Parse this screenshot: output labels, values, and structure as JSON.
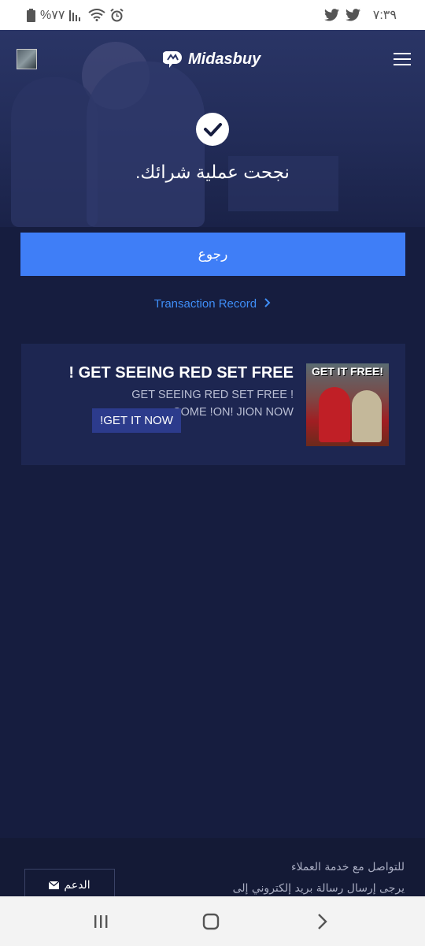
{
  "status_bar": {
    "battery": "%٧٧",
    "time": "٧:٣٩"
  },
  "header": {
    "brand": "Midasbuy"
  },
  "result": {
    "message": "نجحت عملية شرائك."
  },
  "actions": {
    "back_label": "رجوع",
    "transaction_link": "Transaction Record"
  },
  "promo": {
    "title": "! GET SEEING RED SET FREE",
    "description": "GET SEEING RED SET FREE ! COME !ON! JION NOW",
    "button_label": "!GET IT NOW",
    "image_text": "GET IT FREE!"
  },
  "footer": {
    "contact_line1": "للتواصل مع خدمة العملاء",
    "contact_line2": "يرجى إرسال رسالة بريد إلكتروني إلى",
    "support_label": "الدعم"
  },
  "colors": {
    "background": "#161d3f",
    "accent": "#3f7ef7",
    "link": "#3f8ef7"
  },
  "icons": [
    "battery-icon",
    "signal-icon",
    "wifi-icon",
    "alarm-icon",
    "twitter-icon",
    "check-icon",
    "menu-icon",
    "mail-icon",
    "chevron-right-icon",
    "recents-icon",
    "home-icon",
    "back-icon"
  ]
}
